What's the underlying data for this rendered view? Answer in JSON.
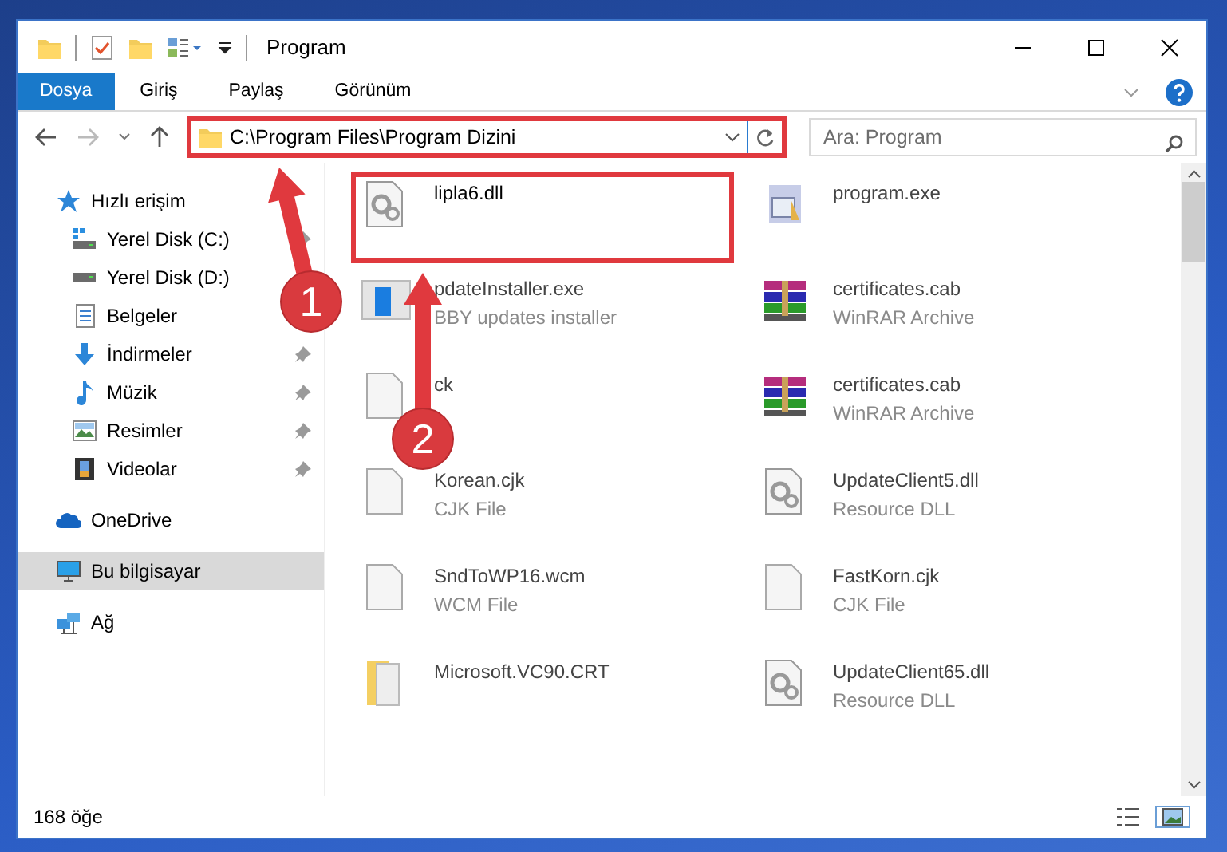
{
  "window": {
    "title": "Program"
  },
  "ribbon_tabs": [
    {
      "label": "Dosya",
      "selected": true
    },
    {
      "label": "Giriş",
      "selected": false
    },
    {
      "label": "Paylaş",
      "selected": false
    },
    {
      "label": "Görünüm",
      "selected": false
    }
  ],
  "address": {
    "path": "C:\\Program Files\\Program Dizini",
    "highlighted": true
  },
  "search": {
    "placeholder": "Ara: Program"
  },
  "sidebar": {
    "items": [
      {
        "label": "Hızlı erişim",
        "kind": "star",
        "selected": false,
        "children": [
          {
            "label": "Yerel Disk (C:)",
            "kind": "drive-c",
            "pinned": true
          },
          {
            "label": "Yerel Disk (D:)",
            "kind": "drive",
            "pinned": false
          },
          {
            "label": "Belgeler",
            "kind": "documents",
            "pinned": false
          },
          {
            "label": "İndirmeler",
            "kind": "downloads",
            "pinned": true
          },
          {
            "label": "Müzik",
            "kind": "music",
            "pinned": true
          },
          {
            "label": "Resimler",
            "kind": "pictures",
            "pinned": true
          },
          {
            "label": "Videolar",
            "kind": "videos",
            "pinned": true
          }
        ]
      },
      {
        "label": "OneDrive",
        "kind": "cloud",
        "selected": false
      },
      {
        "label": "Bu bilgisayar",
        "kind": "computer",
        "selected": true
      },
      {
        "label": "Ağ",
        "kind": "network",
        "selected": false
      }
    ]
  },
  "files": [
    {
      "name": "lipla6.dll",
      "kind": "dll",
      "highlighted": true
    },
    {
      "name": "program.exe",
      "kind": "exe",
      "highlighted": false
    },
    {
      "name": "pdateInstaller.exe",
      "type": "BBY updates installer",
      "kind": "installer",
      "highlighted": false
    },
    {
      "name": "certificates.cab",
      "type": "WinRAR Archive",
      "kind": "archive",
      "highlighted": false
    },
    {
      "name": "ck",
      "kind": "file",
      "highlighted": false
    },
    {
      "name": "certificates.cab",
      "type": "WinRAR Archive",
      "kind": "archive",
      "highlighted": false
    },
    {
      "name": "Korean.cjk",
      "type": "CJK File",
      "kind": "file",
      "highlighted": false
    },
    {
      "name": "UpdateClient5.dll",
      "type": "Resource DLL",
      "kind": "dll",
      "highlighted": false
    },
    {
      "name": "SndToWP16.wcm",
      "type": "WCM File",
      "kind": "file",
      "highlighted": false
    },
    {
      "name": "FastKorn.cjk",
      "type": "CJK File",
      "kind": "file",
      "highlighted": false
    },
    {
      "name": "Microsoft.VC90.CRT",
      "kind": "folder",
      "highlighted": false
    },
    {
      "name": "UpdateClient65.dll",
      "type": "Resource DLL",
      "kind": "dll",
      "highlighted": false
    }
  ],
  "status_bar": {
    "count": "168 öğe"
  },
  "callouts": [
    {
      "number": "1"
    },
    {
      "number": "2"
    }
  ]
}
